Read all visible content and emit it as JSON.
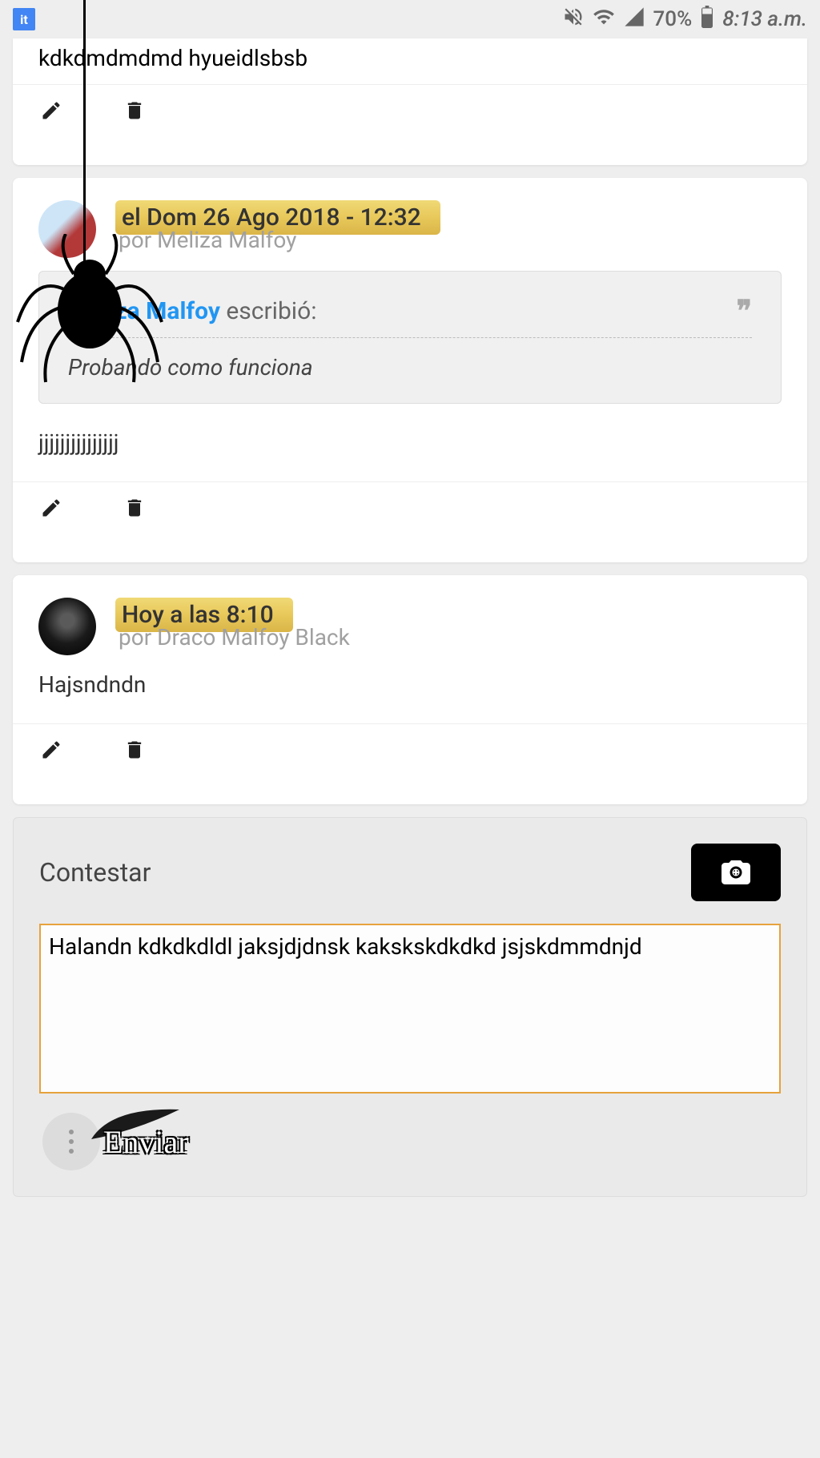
{
  "status_bar": {
    "app_icon_text": "it",
    "battery_percent": "70%",
    "time": "8:13 a.m."
  },
  "posts": [
    {
      "content": "kdkdmdmdmd hyueidlsbsb"
    },
    {
      "timestamp": "el Dom 26 Ago 2018 - 12:32",
      "author_prefix": "por",
      "author": "Meliza Malfoy",
      "quote": {
        "author": "Meliza Malfoy",
        "wrote_label": "escribió:",
        "text": "Probando como funciona"
      },
      "content": "jjjjjjjjjjjjjjj"
    },
    {
      "timestamp": "Hoy a las 8:10",
      "author_prefix": "por",
      "author": "Draco Malfoy Black",
      "content": "Hajsndndn"
    }
  ],
  "reply": {
    "title": "Contestar",
    "text": "Halandn kdkdkdldl jaksjdjdnsk kakskskdkdkd jsjskdmmdnjd",
    "send_label": "Enviar"
  }
}
